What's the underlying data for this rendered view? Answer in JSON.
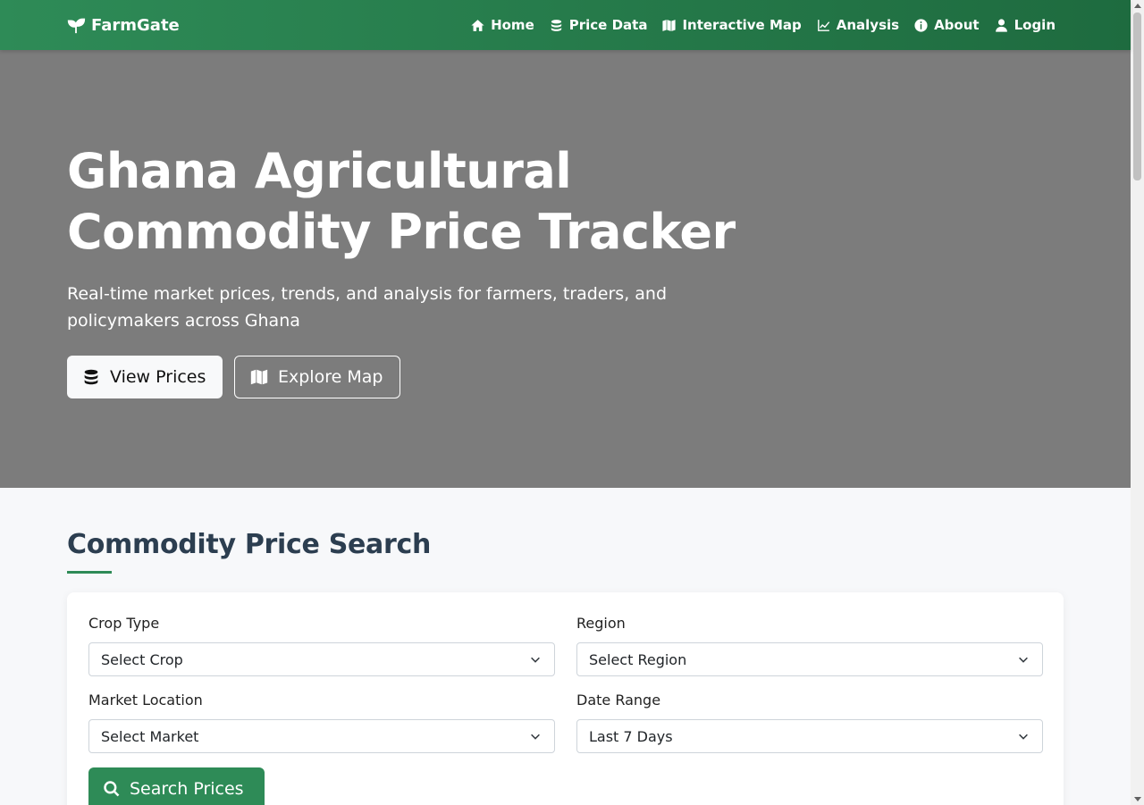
{
  "nav": {
    "brand": "FarmGate",
    "items": [
      {
        "label": "Home",
        "icon": "home-icon"
      },
      {
        "label": "Price Data",
        "icon": "coins-icon"
      },
      {
        "label": "Interactive Map",
        "icon": "map-icon"
      },
      {
        "label": "Analysis",
        "icon": "chart-line-icon"
      },
      {
        "label": "About",
        "icon": "info-icon"
      },
      {
        "label": "Login",
        "icon": "user-icon"
      }
    ]
  },
  "hero": {
    "title_line1": "Ghana Agricultural",
    "title_line2": "Commodity Price Tracker",
    "subtitle": "Real-time market prices, trends, and analysis for farmers, traders, and policymakers across Ghana",
    "btn_view_prices": "View Prices",
    "btn_explore_map": "Explore Map"
  },
  "search": {
    "title": "Commodity Price Search",
    "crop_label": "Crop Type",
    "crop_value": "Select Crop",
    "region_label": "Region",
    "region_value": "Select Region",
    "market_label": "Market Location",
    "market_value": "Select Market",
    "date_label": "Date Range",
    "date_value": "Last 7 Days",
    "button": "Search Prices"
  },
  "colors": {
    "brand_green": "#2e8b57",
    "hero_bg": "#7c7c7c",
    "heading": "#2c3e50"
  }
}
